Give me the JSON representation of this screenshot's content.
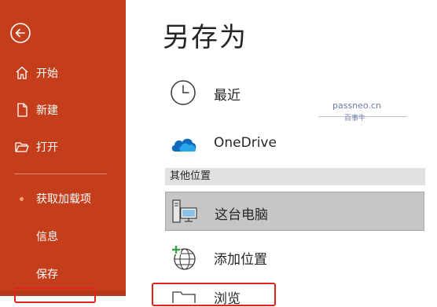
{
  "sidebar": {
    "back_icon": "back-arrow-icon",
    "items": [
      {
        "label": "开始",
        "icon": "home-icon"
      },
      {
        "label": "新建",
        "icon": "new-document-icon"
      },
      {
        "label": "打开",
        "icon": "open-folder-icon"
      },
      {
        "label": "获取加载项",
        "icon": "dot-indicator"
      },
      {
        "label": "信息"
      },
      {
        "label": "保存"
      }
    ]
  },
  "main": {
    "title": "另存为",
    "locations": [
      {
        "label": "最近",
        "icon": "clock-icon"
      },
      {
        "label": "OneDrive",
        "icon": "onedrive-cloud-icon"
      }
    ],
    "section_header": "其他位置",
    "other_locations": [
      {
        "label": "这台电脑",
        "icon": "this-pc-icon",
        "selected": true
      },
      {
        "label": "添加位置",
        "icon": "add-place-icon"
      },
      {
        "label": "浏览",
        "icon": "folder-icon"
      }
    ]
  },
  "watermark": {
    "line1": "passneo.cn",
    "line2": "百事牛"
  },
  "colors": {
    "sidebar_bg": "#c43e1c",
    "highlight": "#e3221c",
    "selected_bg": "#c6c6c6"
  }
}
